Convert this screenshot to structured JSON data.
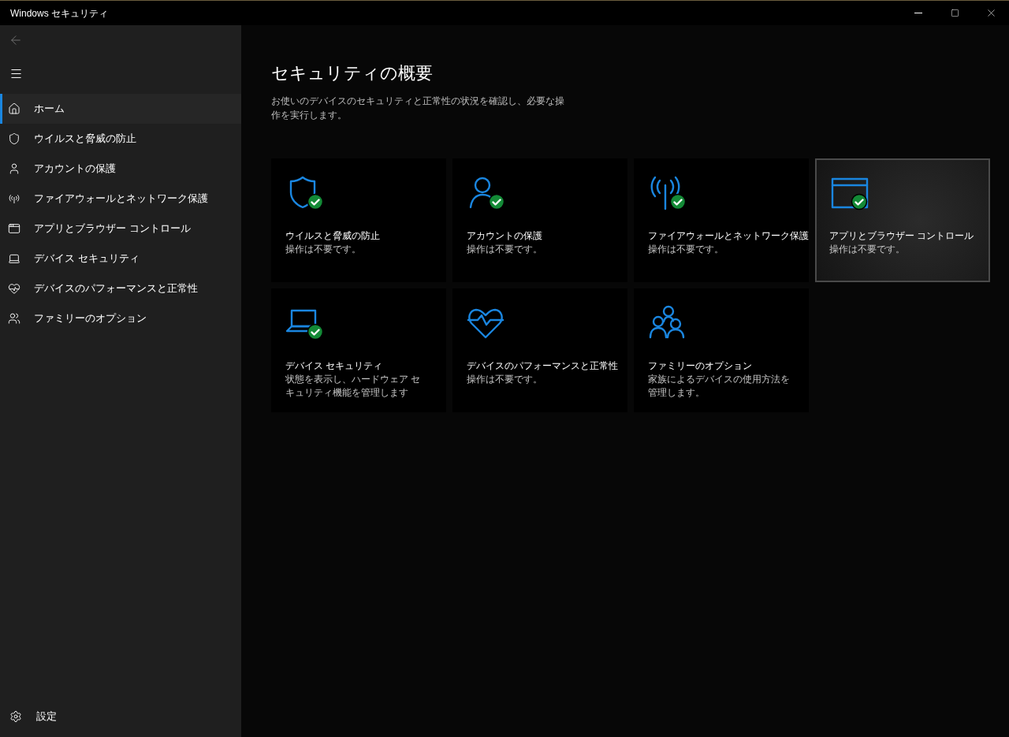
{
  "window": {
    "title": "Windows セキュリティ"
  },
  "sidebar": {
    "items": [
      {
        "label": "ホーム",
        "selected": true
      },
      {
        "label": "ウイルスと脅威の防止",
        "selected": false
      },
      {
        "label": "アカウントの保護",
        "selected": false
      },
      {
        "label": "ファイアウォールとネットワーク保護",
        "selected": false
      },
      {
        "label": "アプリとブラウザー コントロール",
        "selected": false
      },
      {
        "label": "デバイス セキュリティ",
        "selected": false
      },
      {
        "label": "デバイスのパフォーマンスと正常性",
        "selected": false
      },
      {
        "label": "ファミリーのオプション",
        "selected": false
      }
    ],
    "settings": "設定"
  },
  "main": {
    "title": "セキュリティの概要",
    "description": "お使いのデバイスのセキュリティと正常性の状況を確認し、必要な操作を実行します。",
    "tiles": [
      {
        "title": "ウイルスと脅威の防止",
        "status": "操作は不要です。",
        "ok": true,
        "highlighted": false
      },
      {
        "title": "アカウントの保護",
        "status": "操作は不要です。",
        "ok": true,
        "highlighted": false
      },
      {
        "title": "ファイアウォールとネットワーク保護",
        "status": "操作は不要です。",
        "ok": true,
        "highlighted": false
      },
      {
        "title": "アプリとブラウザー コントロール",
        "status": "操作は不要です。",
        "ok": true,
        "highlighted": true
      },
      {
        "title": "デバイス セキュリティ",
        "status": "状態を表示し、ハードウェア セキュリティ機能を管理します",
        "ok": true,
        "highlighted": false
      },
      {
        "title": "デバイスのパフォーマンスと正常性",
        "status": "操作は不要です。",
        "ok": false,
        "highlighted": false
      },
      {
        "title": "ファミリーのオプション",
        "status": "家族によるデバイスの使用方法を管理します。",
        "ok": false,
        "highlighted": false
      }
    ]
  }
}
